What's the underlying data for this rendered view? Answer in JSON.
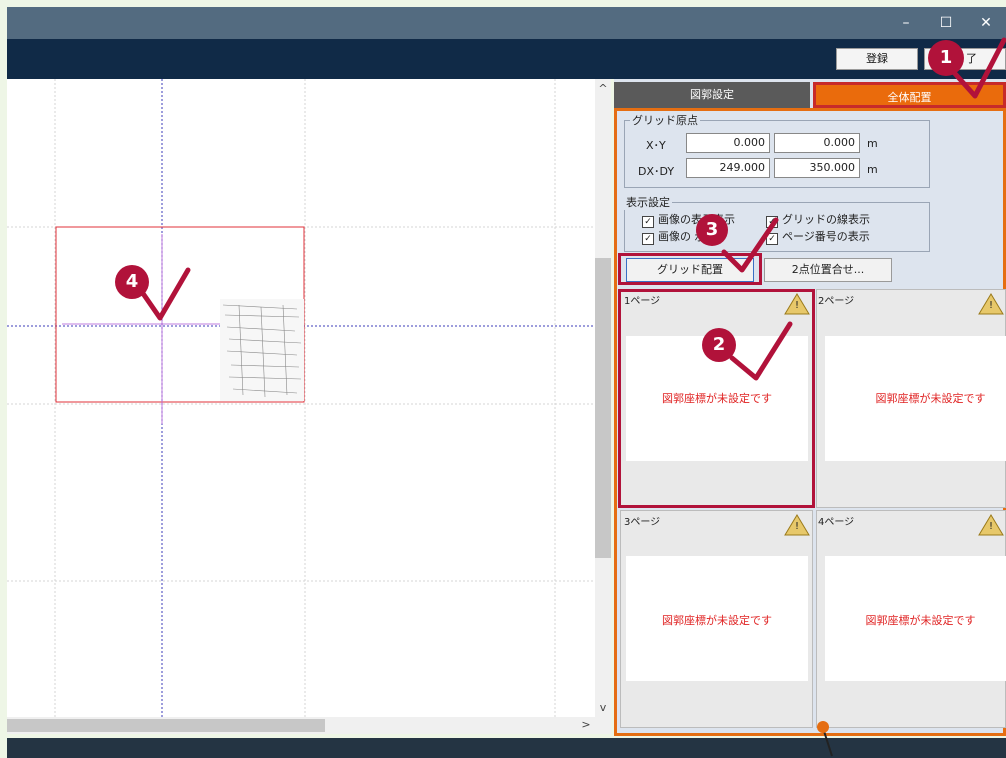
{
  "window": {
    "minimize_symbol": "–",
    "maximize_symbol": "☐",
    "close_symbol": "✕"
  },
  "toolbar": {
    "register_label": "登録",
    "finish_label": "了"
  },
  "tabs": [
    {
      "label": "図郭設定"
    },
    {
      "label": "全体配置"
    }
  ],
  "grid_origin": {
    "title": "グリッド原点",
    "xy_label": "X･Y",
    "dxdy_label": "DX･DY",
    "x": "0.000",
    "y": "0.000",
    "dx": "249.000",
    "dy": "350.000",
    "unit": "m"
  },
  "display_settings": {
    "title": "表示設定",
    "options": [
      {
        "label": "画像の表示表示",
        "checked": true
      },
      {
        "label": "グリッドの線表示",
        "checked": true
      },
      {
        "label": "画像の 示",
        "checked": true
      },
      {
        "label": "ページ番号の表示",
        "checked": true
      }
    ]
  },
  "buttons": {
    "grid_place": "グリッド配置",
    "two_point": "2点位置合せ..."
  },
  "pages": [
    {
      "title": "1ページ",
      "warning_icon": "!",
      "message": "図郭座標が未設定です"
    },
    {
      "title": "2ページ",
      "warning_icon": "!",
      "message": "図郭座標が未設定です"
    },
    {
      "title": "3ページ",
      "warning_icon": "!",
      "message": "図郭座標が未設定です"
    },
    {
      "title": "4ページ",
      "warning_icon": "!",
      "message": "図郭座標が未設定です"
    }
  ],
  "scroll": {
    "up_arrow": "^",
    "down_arrow": "v",
    "left_arrow": "<",
    "right_arrow": ">"
  },
  "annotations": {
    "badge1": "1",
    "badge2": "2",
    "badge3": "3",
    "badge4": "4"
  },
  "colors": {
    "accent_orange": "#ea6b0c",
    "badge_red": "#b1123a",
    "error_red": "#e02424",
    "toolbar_navy": "#102a47"
  }
}
